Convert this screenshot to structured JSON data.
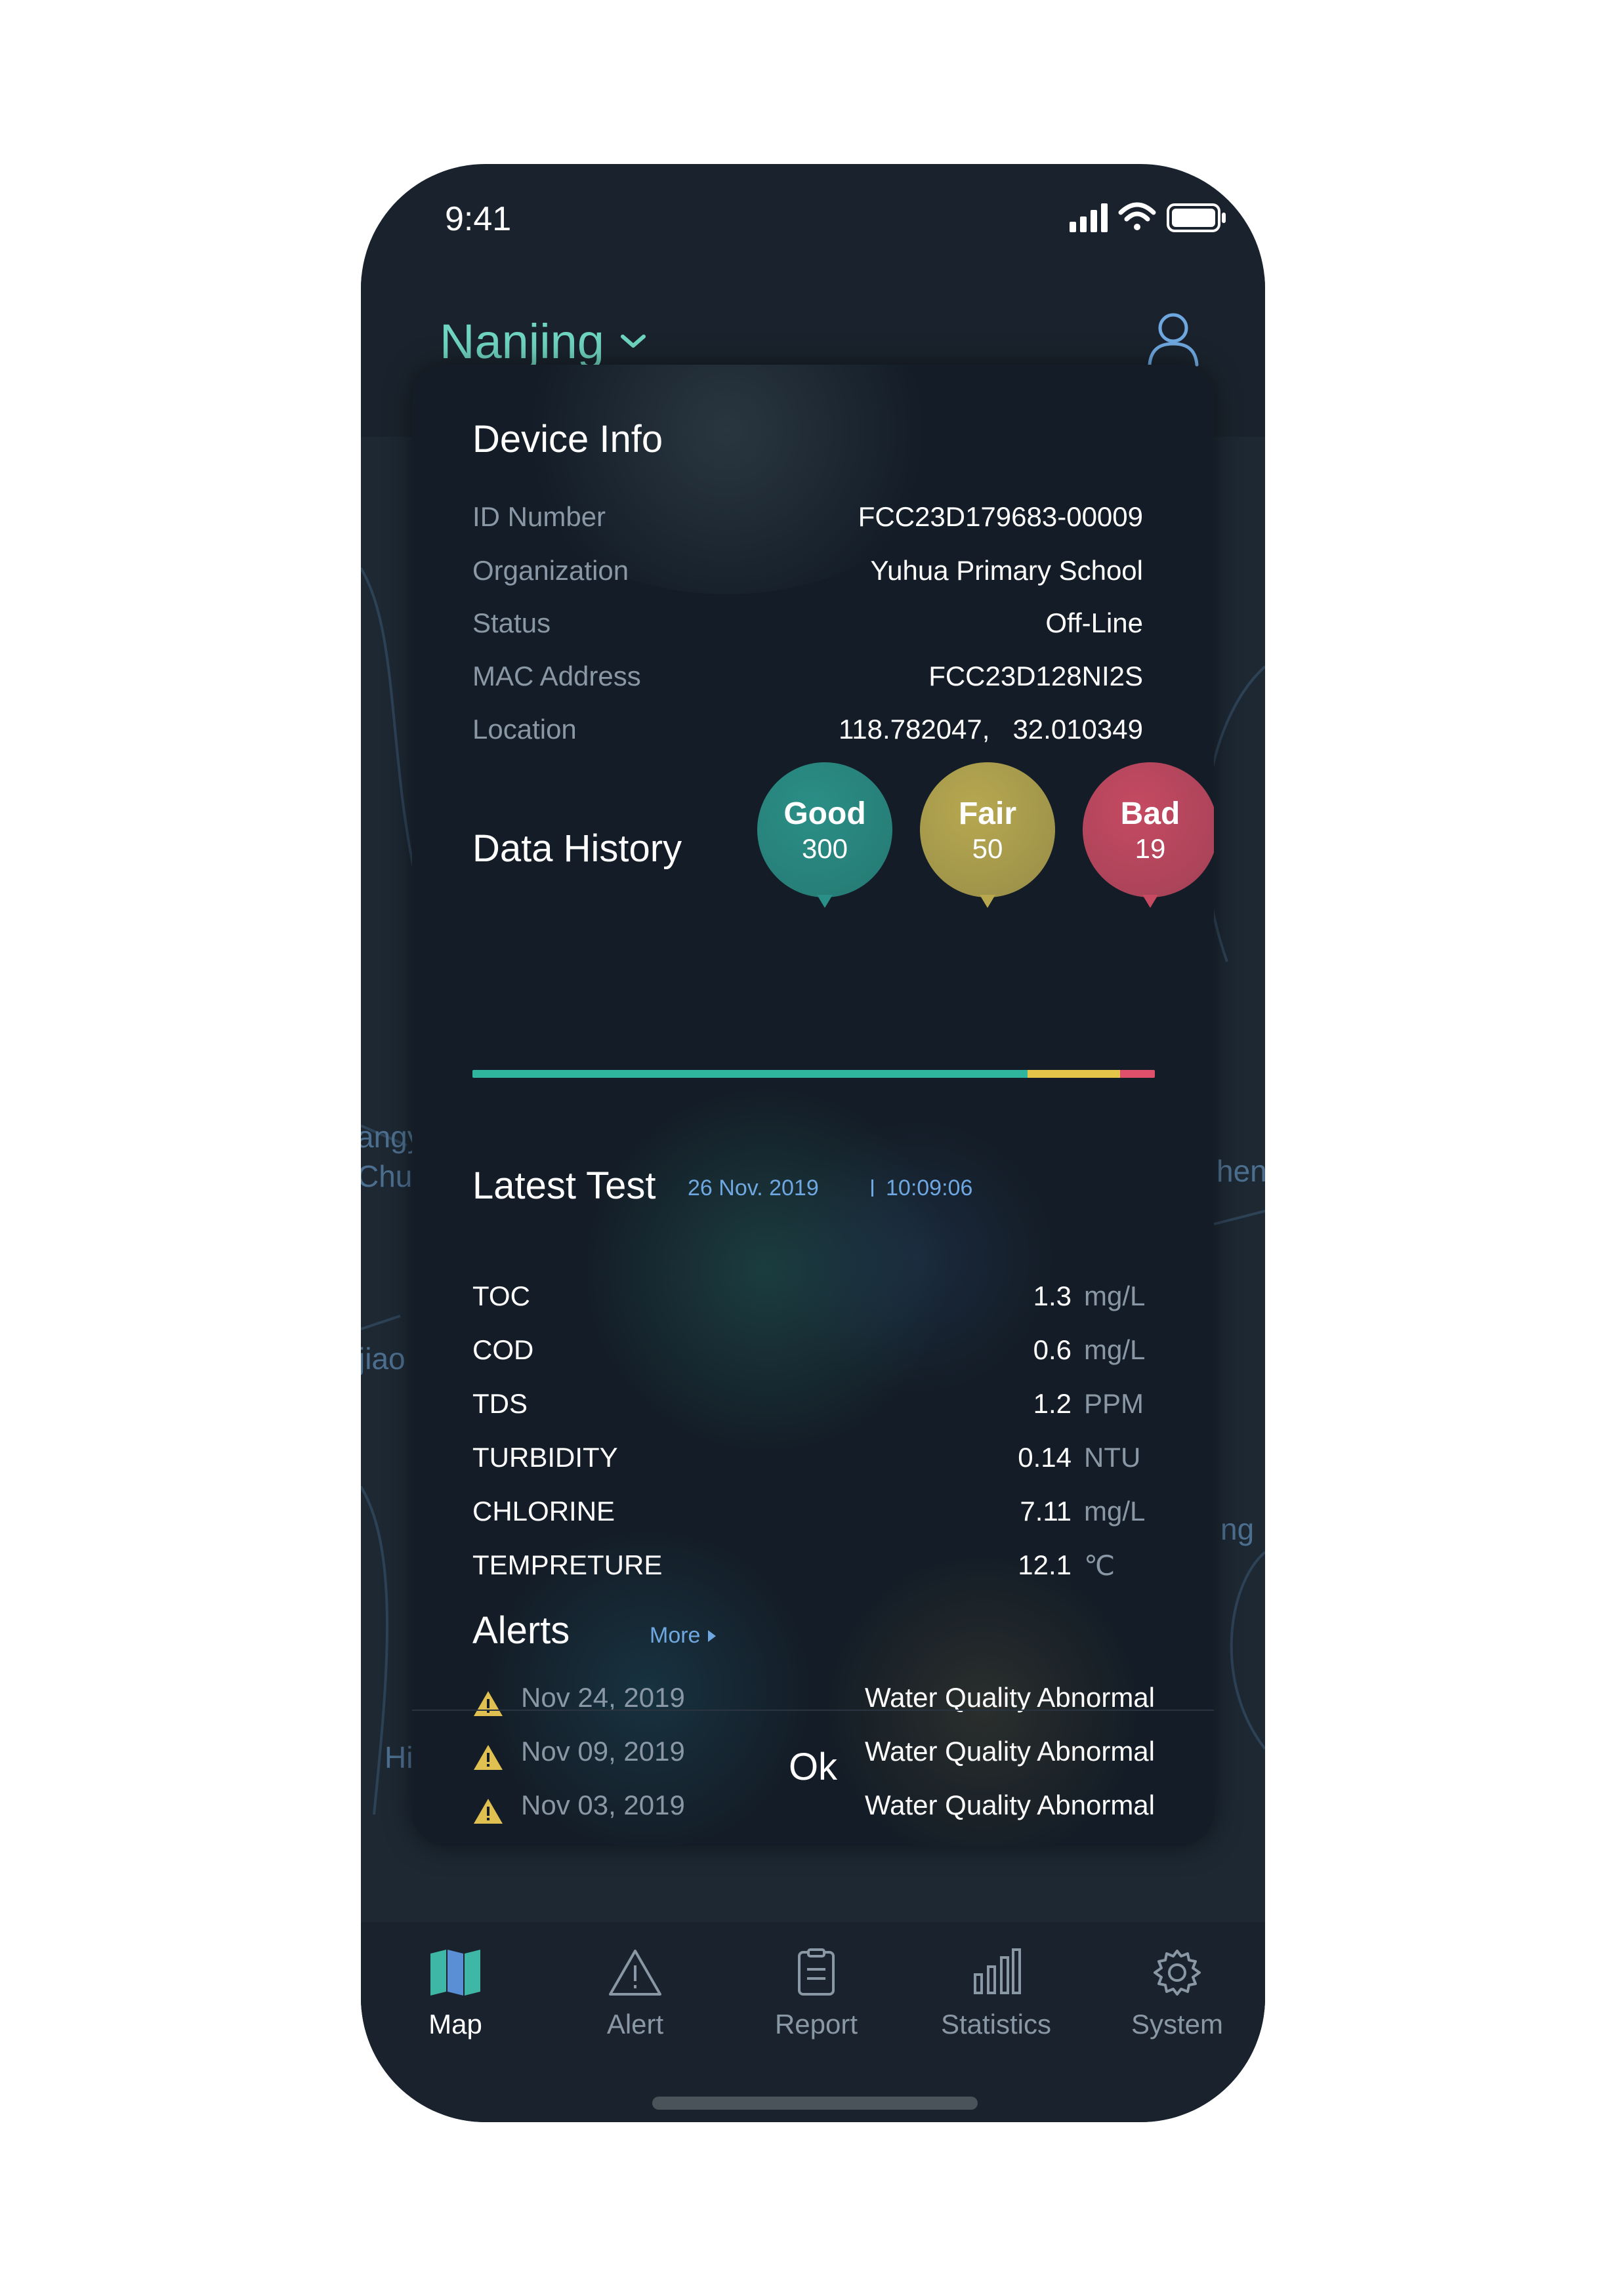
{
  "status_bar": {
    "time": "9:41"
  },
  "header": {
    "city": "Nanjing"
  },
  "map": {
    "labels": [
      "angy",
      "Chu:",
      "jiao",
      "Hi",
      "hen",
      "ng"
    ]
  },
  "device_info": {
    "title": "Device Info",
    "rows": [
      {
        "label": "ID Number",
        "value": "FCC23D179683-00009"
      },
      {
        "label": "Organization",
        "value": "Yuhua Primary School"
      },
      {
        "label": "Status",
        "value": "Off-Line"
      },
      {
        "label": "MAC Address",
        "value": "FCC23D128NI2S"
      },
      {
        "label": "Location",
        "value": "118.782047,   32.010349"
      }
    ]
  },
  "data_history": {
    "title": "Data History",
    "good": {
      "label": "Good",
      "count": "300",
      "color": "#2a8f86"
    },
    "fair": {
      "label": "Fair",
      "count": "50",
      "color": "#b7a850"
    },
    "bad": {
      "label": "Bad",
      "count": "19",
      "color": "#c54a62"
    },
    "bar_fractions": {
      "good": 0.813,
      "fair": 0.136,
      "bad": 0.051
    }
  },
  "latest_test": {
    "title": "Latest Test",
    "date": "26 Nov. 2019",
    "time": "10:09:06",
    "rows": [
      {
        "label": "TOC",
        "value": "1.3",
        "unit": "mg/L"
      },
      {
        "label": "COD",
        "value": "0.6",
        "unit": "mg/L"
      },
      {
        "label": "TDS",
        "value": "1.2",
        "unit": "PPM"
      },
      {
        "label": "TURBIDITY",
        "value": "0.14",
        "unit": "NTU"
      },
      {
        "label": "CHLORINE",
        "value": "7.11",
        "unit": "mg/L"
      },
      {
        "label": "TEMPRETURE",
        "value": "12.1",
        "unit": "℃"
      }
    ]
  },
  "alerts": {
    "title": "Alerts",
    "more_label": "More",
    "items": [
      {
        "date": "Nov 24, 2019",
        "message": "Water Quality Abnormal"
      },
      {
        "date": "Nov 09, 2019",
        "message": "Water Quality Abnormal"
      },
      {
        "date": "Nov 03, 2019",
        "message": "Water Quality Abnormal"
      }
    ]
  },
  "ok_label": "Ok",
  "tabs": [
    {
      "label": "Map",
      "icon": "map-icon",
      "active": true
    },
    {
      "label": "Alert",
      "icon": "alert-icon",
      "active": false
    },
    {
      "label": "Report",
      "icon": "report-icon",
      "active": false
    },
    {
      "label": "Statistics",
      "icon": "statistics-icon",
      "active": false
    },
    {
      "label": "System",
      "icon": "gear-icon",
      "active": false
    }
  ],
  "colors": {
    "accent": "#6fd4c1",
    "link": "#6fa8e0",
    "warning": "#e0c050"
  }
}
